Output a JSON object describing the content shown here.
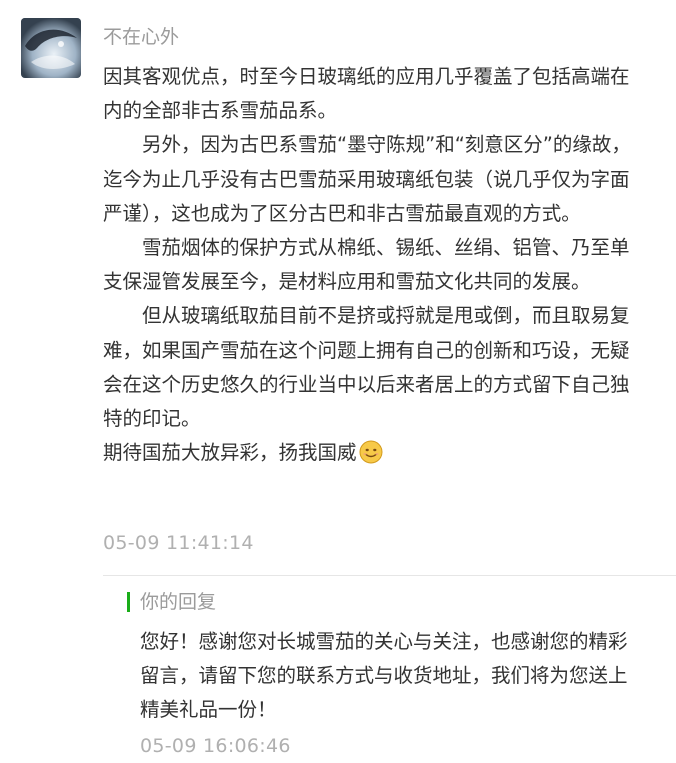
{
  "comment": {
    "avatar_icon": "user-avatar-icon",
    "nickname": "不在心外",
    "paragraphs": [
      "因其客观优点，时至今日玻璃纸的应用几乎覆盖了包括高端在内的全部非古系雪茄品系。",
      "另外，因为古巴系雪茄“墨守陈规”和“刻意区分”的缘故，迄今为止几乎没有古巴雪茄采用玻璃纸包装（说几乎仅为字面严谨），这也成为了区分古巴和非古雪茄最直观的方式。",
      "雪茄烟体的保护方式从棉纸、锡纸、丝绢、铝管、乃至单支保湿管发展至今，是材料应用和雪茄文化共同的发展。",
      "但从玻璃纸取茄目前不是挤或捋就是甩或倒，而且取易复难，如果国产雪茄在这个问题上拥有自己的创新和巧设，无疑会在这个历史悠久的行业当中以后来者居上的方式留下自己独特的印记。",
      "期待国茄大放异彩，扬我国威"
    ],
    "emoji_icon": "smile-emoji-icon",
    "time": "05-09 11:41:14"
  },
  "reply": {
    "title": "你的回复",
    "accent_color": "#1aad19",
    "text": "您好！感谢您对长城雪茄的关心与关注，也感谢您的精彩留言，请留下您的联系方式与收货地址，我们将为您送上精美礼品一份！",
    "time": "05-09 16:06:46"
  }
}
